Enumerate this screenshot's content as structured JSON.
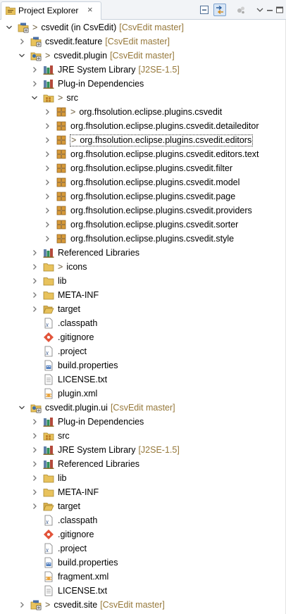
{
  "view": {
    "title": "Project Explorer",
    "close_glyph": "×",
    "toolbar": [
      {
        "name": "collapse-all-icon",
        "pressed": false
      },
      {
        "name": "link-with-editor-icon",
        "pressed": true
      },
      {
        "name": "view-menu-extra-icon",
        "pressed": false
      },
      {
        "name": "view-menu-chevron-icon",
        "pressed": false
      },
      {
        "name": "minimize-icon",
        "pressed": false
      },
      {
        "name": "maximize-icon",
        "pressed": false
      }
    ]
  },
  "colors": {
    "decoration": "#96783a",
    "folder": "#e8c25c",
    "package": "#c0822a",
    "project": "#4a6fa5"
  },
  "tree": [
    {
      "depth": 0,
      "exp": "open",
      "icon": "project",
      "dirty": true,
      "label": "csvedit (in CsvEdit)",
      "deco": "[CsvEdit master]"
    },
    {
      "depth": 1,
      "exp": "closed",
      "icon": "project",
      "dirty": false,
      "label": "csvedit.feature",
      "deco": "[CsvEdit master]"
    },
    {
      "depth": 1,
      "exp": "open",
      "icon": "plugin-project",
      "dirty": true,
      "label": "csvedit.plugin",
      "deco": "[CsvEdit master]"
    },
    {
      "depth": 2,
      "exp": "closed",
      "icon": "library",
      "dirty": false,
      "label": "JRE System Library",
      "deco": "[J2SE-1.5]"
    },
    {
      "depth": 2,
      "exp": "closed",
      "icon": "library",
      "dirty": false,
      "label": "Plug-in Dependencies",
      "deco": ""
    },
    {
      "depth": 2,
      "exp": "open",
      "icon": "source-folder",
      "dirty": true,
      "label": "src",
      "deco": ""
    },
    {
      "depth": 3,
      "exp": "closed",
      "icon": "package",
      "dirty": true,
      "label": "org.fhsolution.eclipse.plugins.csvedit",
      "deco": ""
    },
    {
      "depth": 3,
      "exp": "closed",
      "icon": "package",
      "dirty": false,
      "label": "org.fhsolution.eclipse.plugins.csvedit.detaileditor",
      "deco": ""
    },
    {
      "depth": 3,
      "exp": "closed",
      "icon": "package",
      "dirty": true,
      "label": "org.fhsolution.eclipse.plugins.csvedit.editors",
      "deco": "",
      "selected": true
    },
    {
      "depth": 3,
      "exp": "closed",
      "icon": "package",
      "dirty": false,
      "label": "org.fhsolution.eclipse.plugins.csvedit.editors.text",
      "deco": ""
    },
    {
      "depth": 3,
      "exp": "closed",
      "icon": "package",
      "dirty": false,
      "label": "org.fhsolution.eclipse.plugins.csvedit.filter",
      "deco": ""
    },
    {
      "depth": 3,
      "exp": "closed",
      "icon": "package",
      "dirty": false,
      "label": "org.fhsolution.eclipse.plugins.csvedit.model",
      "deco": ""
    },
    {
      "depth": 3,
      "exp": "closed",
      "icon": "package",
      "dirty": false,
      "label": "org.fhsolution.eclipse.plugins.csvedit.page",
      "deco": ""
    },
    {
      "depth": 3,
      "exp": "closed",
      "icon": "package",
      "dirty": false,
      "label": "org.fhsolution.eclipse.plugins.csvedit.providers",
      "deco": ""
    },
    {
      "depth": 3,
      "exp": "closed",
      "icon": "package",
      "dirty": false,
      "label": "org.fhsolution.eclipse.plugins.csvedit.sorter",
      "deco": ""
    },
    {
      "depth": 3,
      "exp": "closed",
      "icon": "package",
      "dirty": false,
      "label": "org.fhsolution.eclipse.plugins.csvedit.style",
      "deco": ""
    },
    {
      "depth": 2,
      "exp": "closed",
      "icon": "library",
      "dirty": false,
      "label": "Referenced Libraries",
      "deco": ""
    },
    {
      "depth": 2,
      "exp": "closed",
      "icon": "folder",
      "dirty": true,
      "label": "icons",
      "deco": ""
    },
    {
      "depth": 2,
      "exp": "closed",
      "icon": "folder",
      "dirty": false,
      "label": "lib",
      "deco": ""
    },
    {
      "depth": 2,
      "exp": "closed",
      "icon": "folder",
      "dirty": false,
      "label": "META-INF",
      "deco": ""
    },
    {
      "depth": 2,
      "exp": "closed",
      "icon": "folder-open",
      "dirty": false,
      "label": "target",
      "deco": ""
    },
    {
      "depth": 2,
      "exp": "none",
      "icon": "file",
      "dirty": false,
      "label": ".classpath",
      "deco": ""
    },
    {
      "depth": 2,
      "exp": "none",
      "icon": "git-file",
      "dirty": false,
      "label": ".gitignore",
      "deco": ""
    },
    {
      "depth": 2,
      "exp": "none",
      "icon": "file",
      "dirty": false,
      "label": ".project",
      "deco": ""
    },
    {
      "depth": 2,
      "exp": "none",
      "icon": "props-file",
      "dirty": false,
      "label": "build.properties",
      "deco": ""
    },
    {
      "depth": 2,
      "exp": "none",
      "icon": "text-file",
      "dirty": false,
      "label": "LICENSE.txt",
      "deco": ""
    },
    {
      "depth": 2,
      "exp": "none",
      "icon": "xml-file",
      "dirty": false,
      "label": "plugin.xml",
      "deco": ""
    },
    {
      "depth": 1,
      "exp": "open",
      "icon": "plugin-project",
      "dirty": false,
      "label": "csvedit.plugin.ui",
      "deco": "[CsvEdit master]"
    },
    {
      "depth": 2,
      "exp": "closed",
      "icon": "library",
      "dirty": false,
      "label": "Plug-in Dependencies",
      "deco": ""
    },
    {
      "depth": 2,
      "exp": "closed",
      "icon": "source-folder",
      "dirty": false,
      "label": "src",
      "deco": ""
    },
    {
      "depth": 2,
      "exp": "closed",
      "icon": "library",
      "dirty": false,
      "label": "JRE System Library",
      "deco": "[J2SE-1.5]"
    },
    {
      "depth": 2,
      "exp": "closed",
      "icon": "library",
      "dirty": false,
      "label": "Referenced Libraries",
      "deco": ""
    },
    {
      "depth": 2,
      "exp": "closed",
      "icon": "folder",
      "dirty": false,
      "label": "lib",
      "deco": ""
    },
    {
      "depth": 2,
      "exp": "closed",
      "icon": "folder",
      "dirty": false,
      "label": "META-INF",
      "deco": ""
    },
    {
      "depth": 2,
      "exp": "closed",
      "icon": "folder-open",
      "dirty": false,
      "label": "target",
      "deco": ""
    },
    {
      "depth": 2,
      "exp": "none",
      "icon": "file",
      "dirty": false,
      "label": ".classpath",
      "deco": ""
    },
    {
      "depth": 2,
      "exp": "none",
      "icon": "git-file",
      "dirty": false,
      "label": ".gitignore",
      "deco": ""
    },
    {
      "depth": 2,
      "exp": "none",
      "icon": "file",
      "dirty": false,
      "label": ".project",
      "deco": ""
    },
    {
      "depth": 2,
      "exp": "none",
      "icon": "props-file",
      "dirty": false,
      "label": "build.properties",
      "deco": ""
    },
    {
      "depth": 2,
      "exp": "none",
      "icon": "xml-file",
      "dirty": false,
      "label": "fragment.xml",
      "deco": ""
    },
    {
      "depth": 2,
      "exp": "none",
      "icon": "text-file",
      "dirty": false,
      "label": "LICENSE.txt",
      "deco": ""
    },
    {
      "depth": 1,
      "exp": "closed",
      "icon": "project",
      "dirty": true,
      "label": "csvedit.site",
      "deco": "[CsvEdit master]"
    }
  ]
}
